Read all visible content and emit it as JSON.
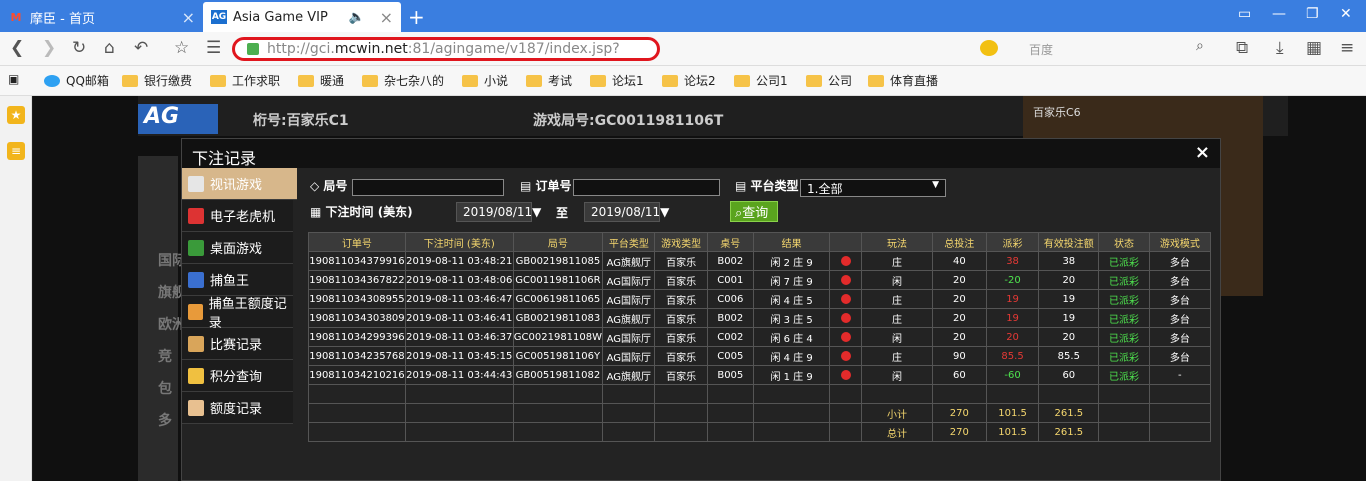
{
  "browser": {
    "tabs": [
      {
        "favicon": "M",
        "title": "摩臣 - 首页"
      },
      {
        "favicon": "AG",
        "title": "Asia Game VIP"
      }
    ],
    "url_prefix": "http://gci.",
    "url_host": "mcwin.net",
    "url_suffix": ":81/agingame/v187/index.jsp?",
    "search_placeholder": "百度",
    "bookmarks": [
      "QQ邮箱",
      "银行缴费",
      "工作求职",
      "暖通",
      "杂七杂八的",
      "小说",
      "考试",
      "论坛1",
      "论坛2",
      "公司1",
      "公司",
      "体育直播"
    ]
  },
  "game": {
    "logo": "AG",
    "table_title": "桁号:百家乐C1",
    "round_title": "游戏局号:GC0011981106T",
    "right_label": "百家乐C6",
    "left_items": [
      "国际",
      "旗舰",
      "欧洲",
      "竞",
      "包",
      "多"
    ]
  },
  "modal": {
    "title": "下注记录",
    "close": "×",
    "menu": [
      "视讯游戏",
      "电子老虎机",
      "桌面游戏",
      "捕鱼王",
      "捕鱼王额度记录",
      "比赛记录",
      "积分查询",
      "额度记录"
    ],
    "filters": {
      "round_label": "局号",
      "order_label": "订单号",
      "platform_label": "平台类型",
      "platform_value": "1.全部",
      "time_label": "下注时间 (美东)",
      "date_from": "2019/08/11▼",
      "to_label": "至",
      "date_to": "2019/08/11▼",
      "query_label": "查询"
    },
    "columns": [
      "订单号",
      "下注时间 (美东)",
      "局号",
      "平台类型",
      "游戏类型",
      "桌号",
      "结果",
      "",
      "玩法",
      "总投注",
      "派彩",
      "有效投注额",
      "状态",
      "游戏模式"
    ],
    "rows": [
      [
        "190811034379916",
        "2019-08-11 03:48:21",
        "GB00219811085",
        "AG旗舰厅",
        "百家乐",
        "B002",
        "闲 2 庄 9",
        "庄",
        "40",
        "38",
        "38",
        "已派彩",
        "多台"
      ],
      [
        "190811034367822",
        "2019-08-11 03:48:06",
        "GC0011981106R",
        "AG国际厅",
        "百家乐",
        "C001",
        "闲 7 庄 9",
        "闲",
        "20",
        "-20",
        "20",
        "已派彩",
        "多台"
      ],
      [
        "190811034308955",
        "2019-08-11 03:46:47",
        "GC00619811065",
        "AG国际厅",
        "百家乐",
        "C006",
        "闲 4 庄 5",
        "庄",
        "20",
        "19",
        "19",
        "已派彩",
        "多台"
      ],
      [
        "190811034303809",
        "2019-08-11 03:46:41",
        "GB00219811083",
        "AG旗舰厅",
        "百家乐",
        "B002",
        "闲 3 庄 5",
        "庄",
        "20",
        "19",
        "19",
        "已派彩",
        "多台"
      ],
      [
        "190811034299396",
        "2019-08-11 03:46:37",
        "GC0021981108W",
        "AG国际厅",
        "百家乐",
        "C002",
        "闲 6 庄 4",
        "闲",
        "20",
        "20",
        "20",
        "已派彩",
        "多台"
      ],
      [
        "190811034235768",
        "2019-08-11 03:45:15",
        "GC0051981106Y",
        "AG国际厅",
        "百家乐",
        "C005",
        "闲 4 庄 9",
        "庄",
        "90",
        "85.5",
        "85.5",
        "已派彩",
        "多台"
      ],
      [
        "190811034210216",
        "2019-08-11 03:44:43",
        "GB00519811082",
        "AG旗舰厅",
        "百家乐",
        "B005",
        "闲 1 庄 9",
        "闲",
        "60",
        "-60",
        "60",
        "已派彩",
        "-"
      ]
    ],
    "payout_colors": [
      "red",
      "green",
      "red",
      "red",
      "red",
      "red",
      "green"
    ],
    "subtotal": {
      "label": "小计",
      "total": "270",
      "payout": "101.5",
      "valid": "261.5"
    },
    "grandtotal": {
      "label": "总计",
      "total": "270",
      "payout": "101.5",
      "valid": "261.5"
    }
  }
}
